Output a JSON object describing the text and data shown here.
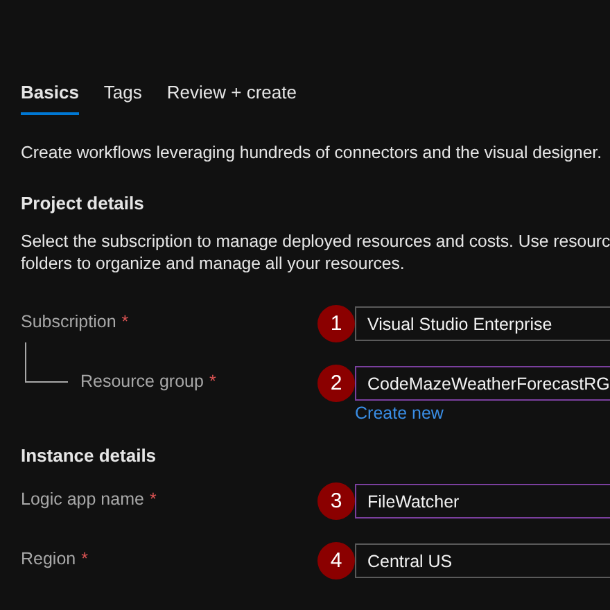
{
  "tabs": [
    {
      "label": "Basics",
      "selected": true
    },
    {
      "label": "Tags",
      "selected": false
    },
    {
      "label": "Review + create",
      "selected": false
    }
  ],
  "intro": "Create workflows leveraging hundreds of connectors and the visual designer.",
  "sections": [
    {
      "heading": "Project details",
      "description": [
        "Select the subscription to manage deployed resources and costs. Use resourc",
        "folders to organize and manage all your resources."
      ],
      "fields": [
        {
          "label": "Subscription",
          "required": "*",
          "nested": false,
          "step": "1",
          "value": "Visual Studio Enterprise",
          "highlighted": false
        },
        {
          "label": "Resource group",
          "required": "*",
          "nested": true,
          "step": "2",
          "value": "CodeMazeWeatherForecastRG",
          "highlighted": true,
          "link": "Create new"
        }
      ]
    },
    {
      "heading": "Instance details",
      "fields": [
        {
          "label": "Logic app name",
          "required": "*",
          "nested": false,
          "step": "3",
          "value": "FileWatcher",
          "highlighted": true
        },
        {
          "label": "Region",
          "required": "*",
          "nested": false,
          "step": "4",
          "value": "Central US",
          "highlighted": false
        }
      ]
    }
  ]
}
